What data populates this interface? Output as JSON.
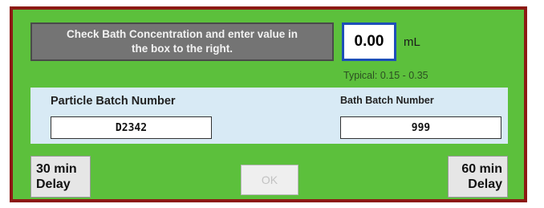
{
  "instruction": {
    "line1": "Check Bath Concentration and enter value in",
    "line2": "the box to the right."
  },
  "concentration": {
    "value": "0.00",
    "unit": "mL",
    "typical": "Typical: 0.15 - 0.35"
  },
  "batch": {
    "particle_label": "Particle Batch Number",
    "particle_value": "D2342",
    "bath_label": "Bath Batch Number",
    "bath_value": "999"
  },
  "buttons": {
    "delay30_line1": "30 min",
    "delay30_line2": "Delay",
    "ok": "OK",
    "delay60_line1": "60 min",
    "delay60_line2": "Delay"
  },
  "colors": {
    "frame": "#8c1a14",
    "panel": "#5cc03c",
    "instruction_bg": "#747474",
    "value_border": "#1e4fb8",
    "batch_strip": "#d8eaf5"
  }
}
